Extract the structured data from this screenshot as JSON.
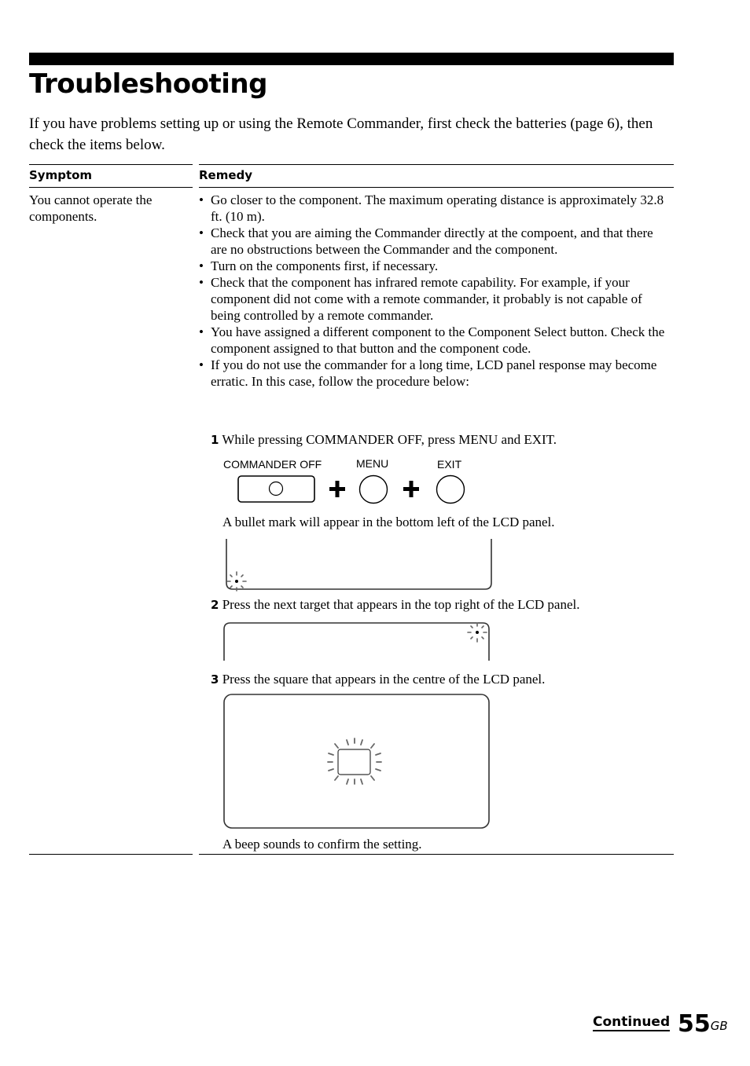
{
  "page": {
    "title": "Troubleshooting",
    "intro": "If you have problems setting up or using the Remote Commander, first check the batteries (page 6), then check the items below.",
    "table": {
      "headers": {
        "symptom": "Symptom",
        "remedy": "Remedy"
      },
      "rows": [
        {
          "symptom": "You cannot operate the components.",
          "remedies": [
            "Go closer to the component. The maximum operating distance is approximately 32.8 ft. (10 m).",
            "Check that you are aiming the Commander directly at the compoent, and that there are no obstructions between the Commander and the component.",
            "Turn on the components first, if necessary.",
            "Check that the component has infrared remote capability. For example, if your component did not come with a remote commander, it probably is not capable of being controlled by a remote commander.",
            "You have assigned a different component to the Component Select button. Check the component assigned to that button and the component code.",
            "If you do not use the commander for a long time, LCD panel response may become erratic. In this case, follow the procedure below:"
          ],
          "steps": [
            {
              "number": "1",
              "text": "While pressing COMMANDER OFF, press MENU and EXIT.",
              "note": "A bullet mark will appear in the bottom left of the LCD panel."
            },
            {
              "number": "2",
              "text": "Press the next target that appears in the top right of the LCD panel.",
              "note": ""
            },
            {
              "number": "3",
              "text": "Press the square that appears in the centre of the LCD panel.",
              "note": "A beep sounds to confirm the setting."
            }
          ],
          "button_labels": {
            "commander_off": "COMMANDER OFF",
            "menu": "MENU",
            "exit": "EXIT"
          }
        }
      ]
    },
    "bullet_glyph": "•",
    "footer": {
      "continued": "Continued",
      "page_number": "55",
      "page_suffix": "GB"
    }
  }
}
